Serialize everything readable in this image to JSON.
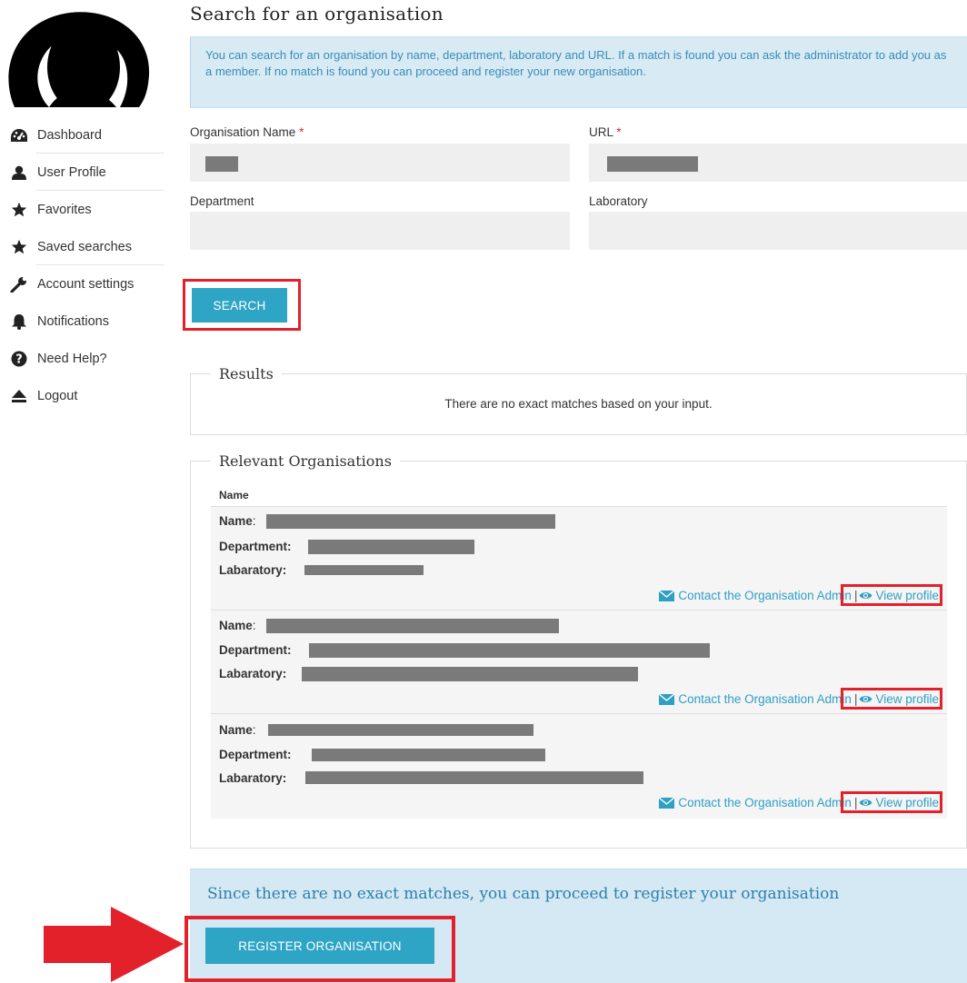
{
  "sidebar": {
    "items": [
      {
        "label": "Dashboard",
        "icon": "dashboard-icon"
      },
      {
        "label": "User Profile",
        "icon": "user-icon"
      },
      {
        "label": "Favorites",
        "icon": "star-icon"
      },
      {
        "label": "Saved searches",
        "icon": "star-icon"
      },
      {
        "label": "Account settings",
        "icon": "wrench-icon"
      },
      {
        "label": "Notifications",
        "icon": "bell-icon"
      },
      {
        "label": "Need Help?",
        "icon": "question-icon"
      },
      {
        "label": "Logout",
        "icon": "eject-icon"
      }
    ]
  },
  "main": {
    "title": "Search for an organisation",
    "info": "You can search for an organisation by name, department, laboratory and URL. If a match is found you can ask the administrator to add you as a member. If no match is found you can proceed and register your new organisation.",
    "form": {
      "org_name_label": "Organisation Name",
      "url_label": "URL",
      "department_label": "Department",
      "laboratory_label": "Laboratory",
      "required_mark": "*"
    },
    "search_button": "SEARCH",
    "results": {
      "legend": "Results",
      "message": "There are no exact matches based on your input."
    },
    "relevant": {
      "legend": "Relevant Organisations",
      "column_header": "Name",
      "field_name": "Name",
      "field_department": "Department:",
      "field_laboratory": "Labaratory:",
      "contact_label": "Contact the Organisation Admin",
      "separator": "|",
      "view_label": "View profile"
    },
    "register": {
      "message": "Since there are no exact matches, you can proceed to register your organisation",
      "button": "REGISTER ORGANISATION"
    }
  },
  "colors": {
    "accent": "#2fa5c6",
    "highlight": "#e3212b",
    "info_bg": "#d8ebf5",
    "link": "#2f9fc4"
  }
}
